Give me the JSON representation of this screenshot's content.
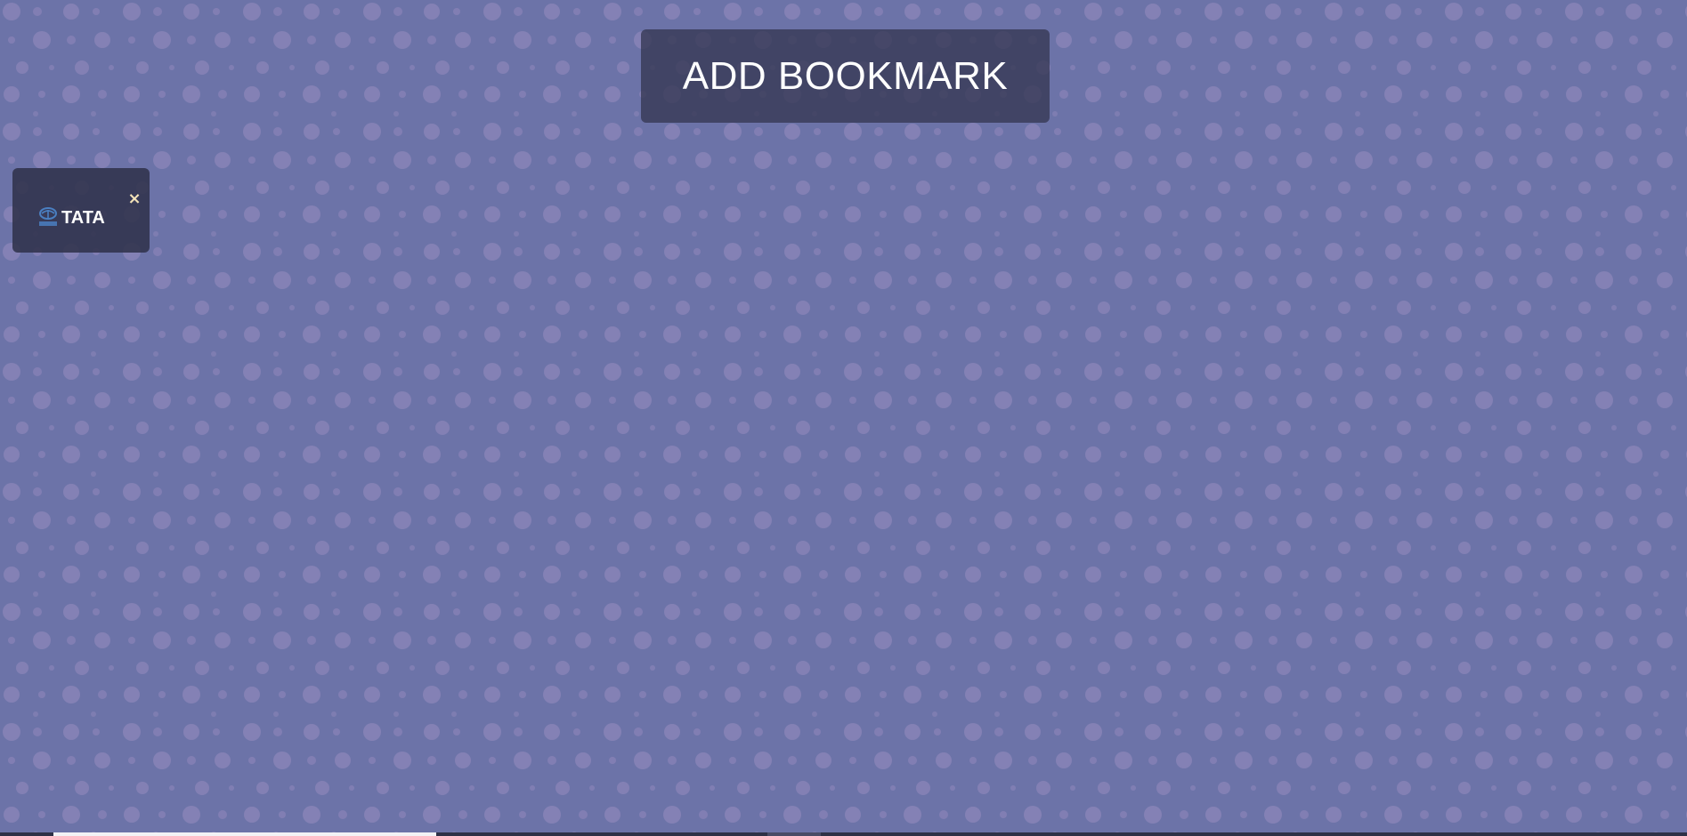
{
  "header": {
    "add_bookmark_label": "ADD BOOKMARK"
  },
  "bookmarks": [
    {
      "label": "TATA",
      "favicon_icon": "tata-logo-icon",
      "close_glyph": "×"
    }
  ],
  "colors": {
    "background": "#6c73a8",
    "dot": "#8a84b8",
    "panel": "#343752",
    "text": "#ffffff",
    "close_icon": "#f3e2b8",
    "favicon_blue": "#4a7fc1"
  }
}
